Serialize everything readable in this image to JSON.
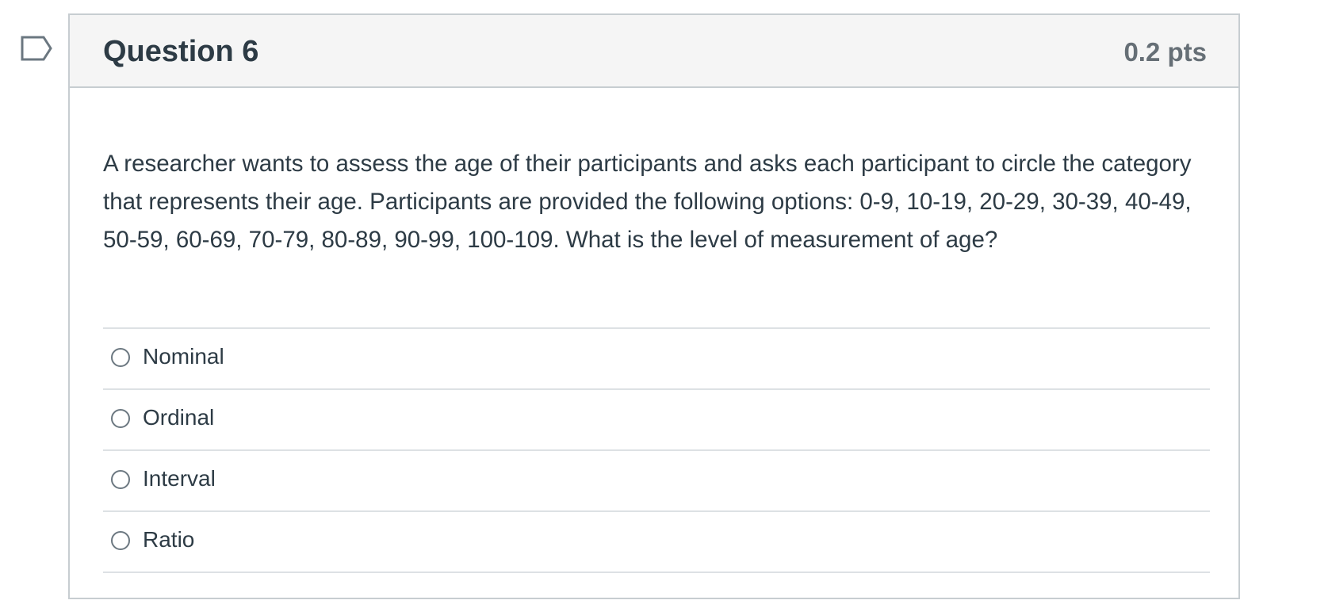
{
  "question": {
    "title": "Question 6",
    "points": "0.2 pts",
    "text": "A researcher wants to assess the age of their participants and asks each participant to circle the category that represents their age. Participants are provided the following options: 0-9, 10-19, 20-29, 30-39, 40-49, 50-59, 60-69, 70-79, 80-89, 90-99, 100-109. What is the level of measurement of age?",
    "answers": [
      {
        "label": "Nominal",
        "selected": false
      },
      {
        "label": "Ordinal",
        "selected": false
      },
      {
        "label": "Interval",
        "selected": false
      },
      {
        "label": "Ratio",
        "selected": false
      }
    ]
  },
  "colors": {
    "header_bg": "#f5f5f5",
    "border": "#c7cdd1",
    "text": "#2d3b45",
    "points_text": "#666f76",
    "flag": "#6b7780"
  }
}
